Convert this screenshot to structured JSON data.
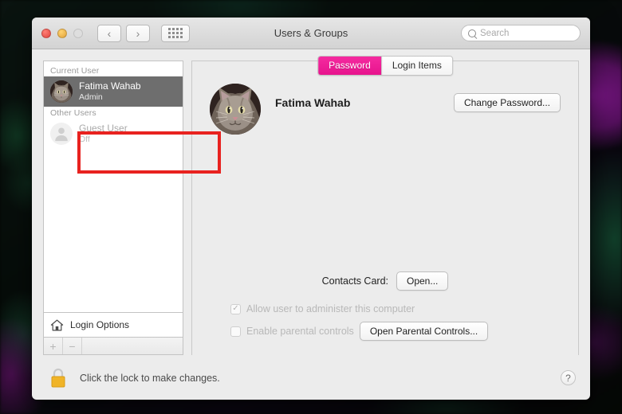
{
  "window": {
    "title": "Users & Groups",
    "traffic_lights": [
      "close-red",
      "minimize-yellow",
      "zoom-green-disabled"
    ],
    "nav_back": "‹",
    "nav_forward": "›",
    "grid_icon": "show-all-grid-icon"
  },
  "search": {
    "placeholder": "Search",
    "value": "",
    "icon": "search-icon"
  },
  "sidebar": {
    "groups": [
      {
        "header": "Current User",
        "users": [
          {
            "name": "Fatima Wahab",
            "status": "Admin",
            "avatar": "cat-photo-avatar",
            "selected": true
          }
        ]
      },
      {
        "header": "Other Users",
        "users": [
          {
            "name": "Guest User",
            "status": "Off",
            "avatar": "person-silhouette-icon",
            "selected": false
          }
        ]
      }
    ],
    "login_options": {
      "label": "Login Options",
      "icon": "home-icon"
    },
    "add_button": "+",
    "remove_button": "−"
  },
  "content": {
    "tabs": [
      {
        "label": "Password",
        "active": true
      },
      {
        "label": "Login Items",
        "active": false
      }
    ],
    "user": {
      "name": "Fatima Wahab",
      "avatar": "cat-photo-avatar"
    },
    "change_password_label": "Change Password...",
    "contacts_card_label": "Contacts Card:",
    "contacts_open_label": "Open...",
    "admin_checkbox": {
      "label": "Allow user to administer this computer",
      "checked": true,
      "check_glyph": "✓",
      "disabled": true
    },
    "parental_checkbox": {
      "label": "Enable parental controls",
      "checked": false,
      "check_glyph": "",
      "disabled": true
    },
    "parental_button_label": "Open Parental Controls..."
  },
  "footer": {
    "lock_icon": "locked-padlock-icon",
    "lock_text": "Click the lock to make changes.",
    "help_label": "?"
  },
  "colors": {
    "tab_accent": "#ED1E95",
    "selection": "#6E6E6E",
    "lock_gold": "#F0B428",
    "annotation_red": "#E8221F",
    "window_bg": "#ECECEC"
  }
}
